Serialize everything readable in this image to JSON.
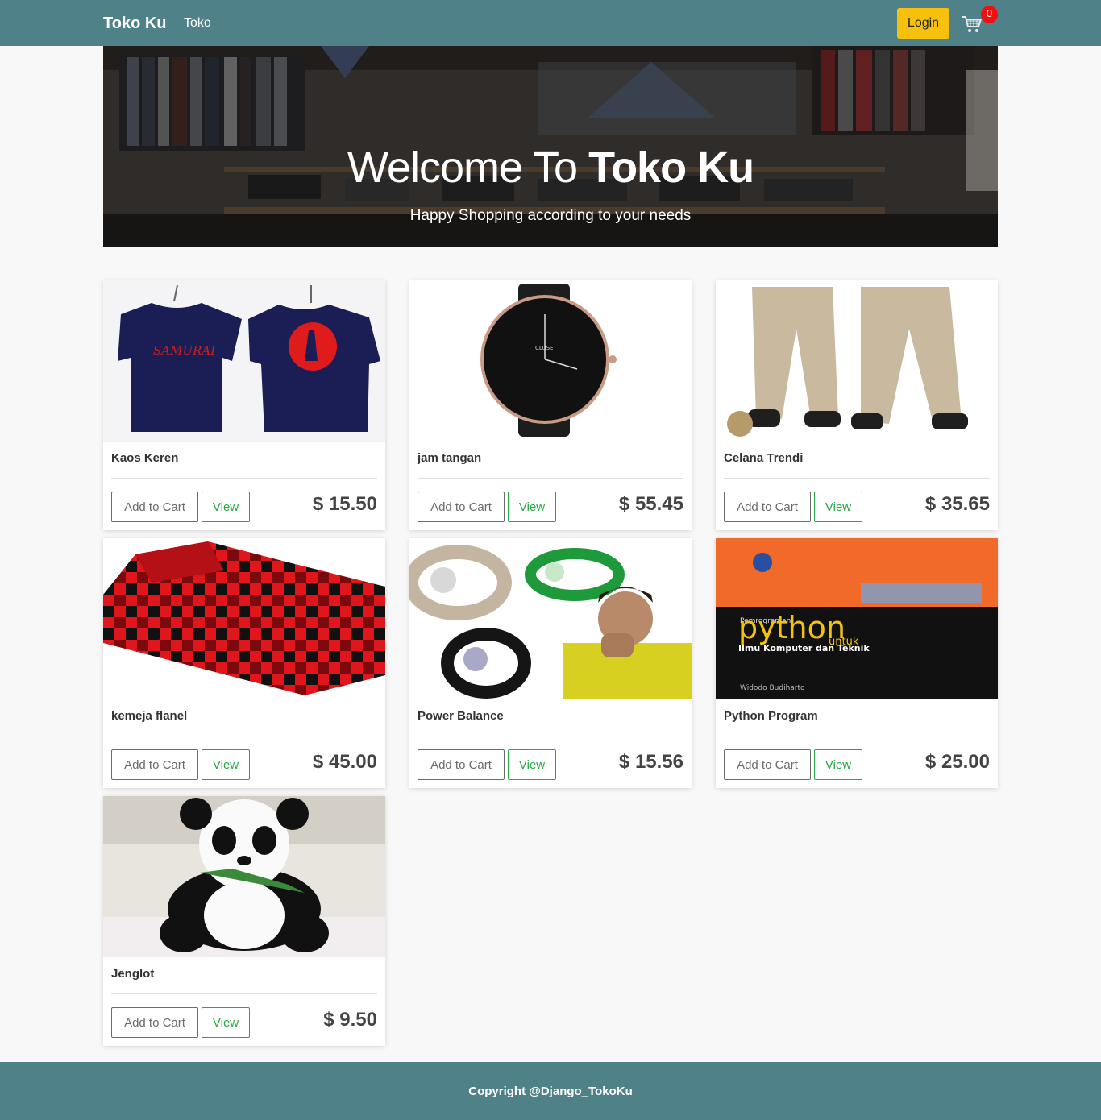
{
  "nav": {
    "brand": "Toko Ku",
    "link": "Toko",
    "login": "Login",
    "cart_count": "0",
    "accent": "#4f8288",
    "login_color": "#f7c00c"
  },
  "hero": {
    "title_prefix": "Welcome To",
    "title_brand": "Toko Ku",
    "subtitle": "Happy Shopping according to your needs"
  },
  "products": [
    {
      "name": "Kaos Keren",
      "price": "$ 15.50",
      "add_label": "Add to Cart",
      "view_label": "View",
      "image": "tshirt-image"
    },
    {
      "name": "jam tangan",
      "price": "$ 55.45",
      "add_label": "Add to Cart",
      "view_label": "View",
      "image": "watch-image"
    },
    {
      "name": "Celana Trendi",
      "price": "$ 35.65",
      "add_label": "Add to Cart",
      "view_label": "View",
      "image": "pants-image"
    },
    {
      "name": "kemeja flanel",
      "price": "$ 45.00",
      "add_label": "Add to Cart",
      "view_label": "View",
      "image": "flannel-shirt-image"
    },
    {
      "name": "Power Balance",
      "price": "$ 15.56",
      "add_label": "Add to Cart",
      "view_label": "View",
      "image": "wristband-image"
    },
    {
      "name": "Python Program",
      "price": "$ 25.00",
      "add_label": "Add to Cart",
      "view_label": "View",
      "image": "book-cover-image"
    },
    {
      "name": "Jenglot",
      "price": "$ 9.50",
      "add_label": "Add to Cart",
      "view_label": "View",
      "image": "panda-doll-image"
    }
  ],
  "book_cover": {
    "small_text": "Pemrograman",
    "title": "python",
    "connector": "untuk",
    "subtitle": "Ilmu Komputer dan Teknik",
    "author": "Widodo Budiharto"
  },
  "footer": {
    "copyright": "Copyright @Django_TokoKu"
  }
}
